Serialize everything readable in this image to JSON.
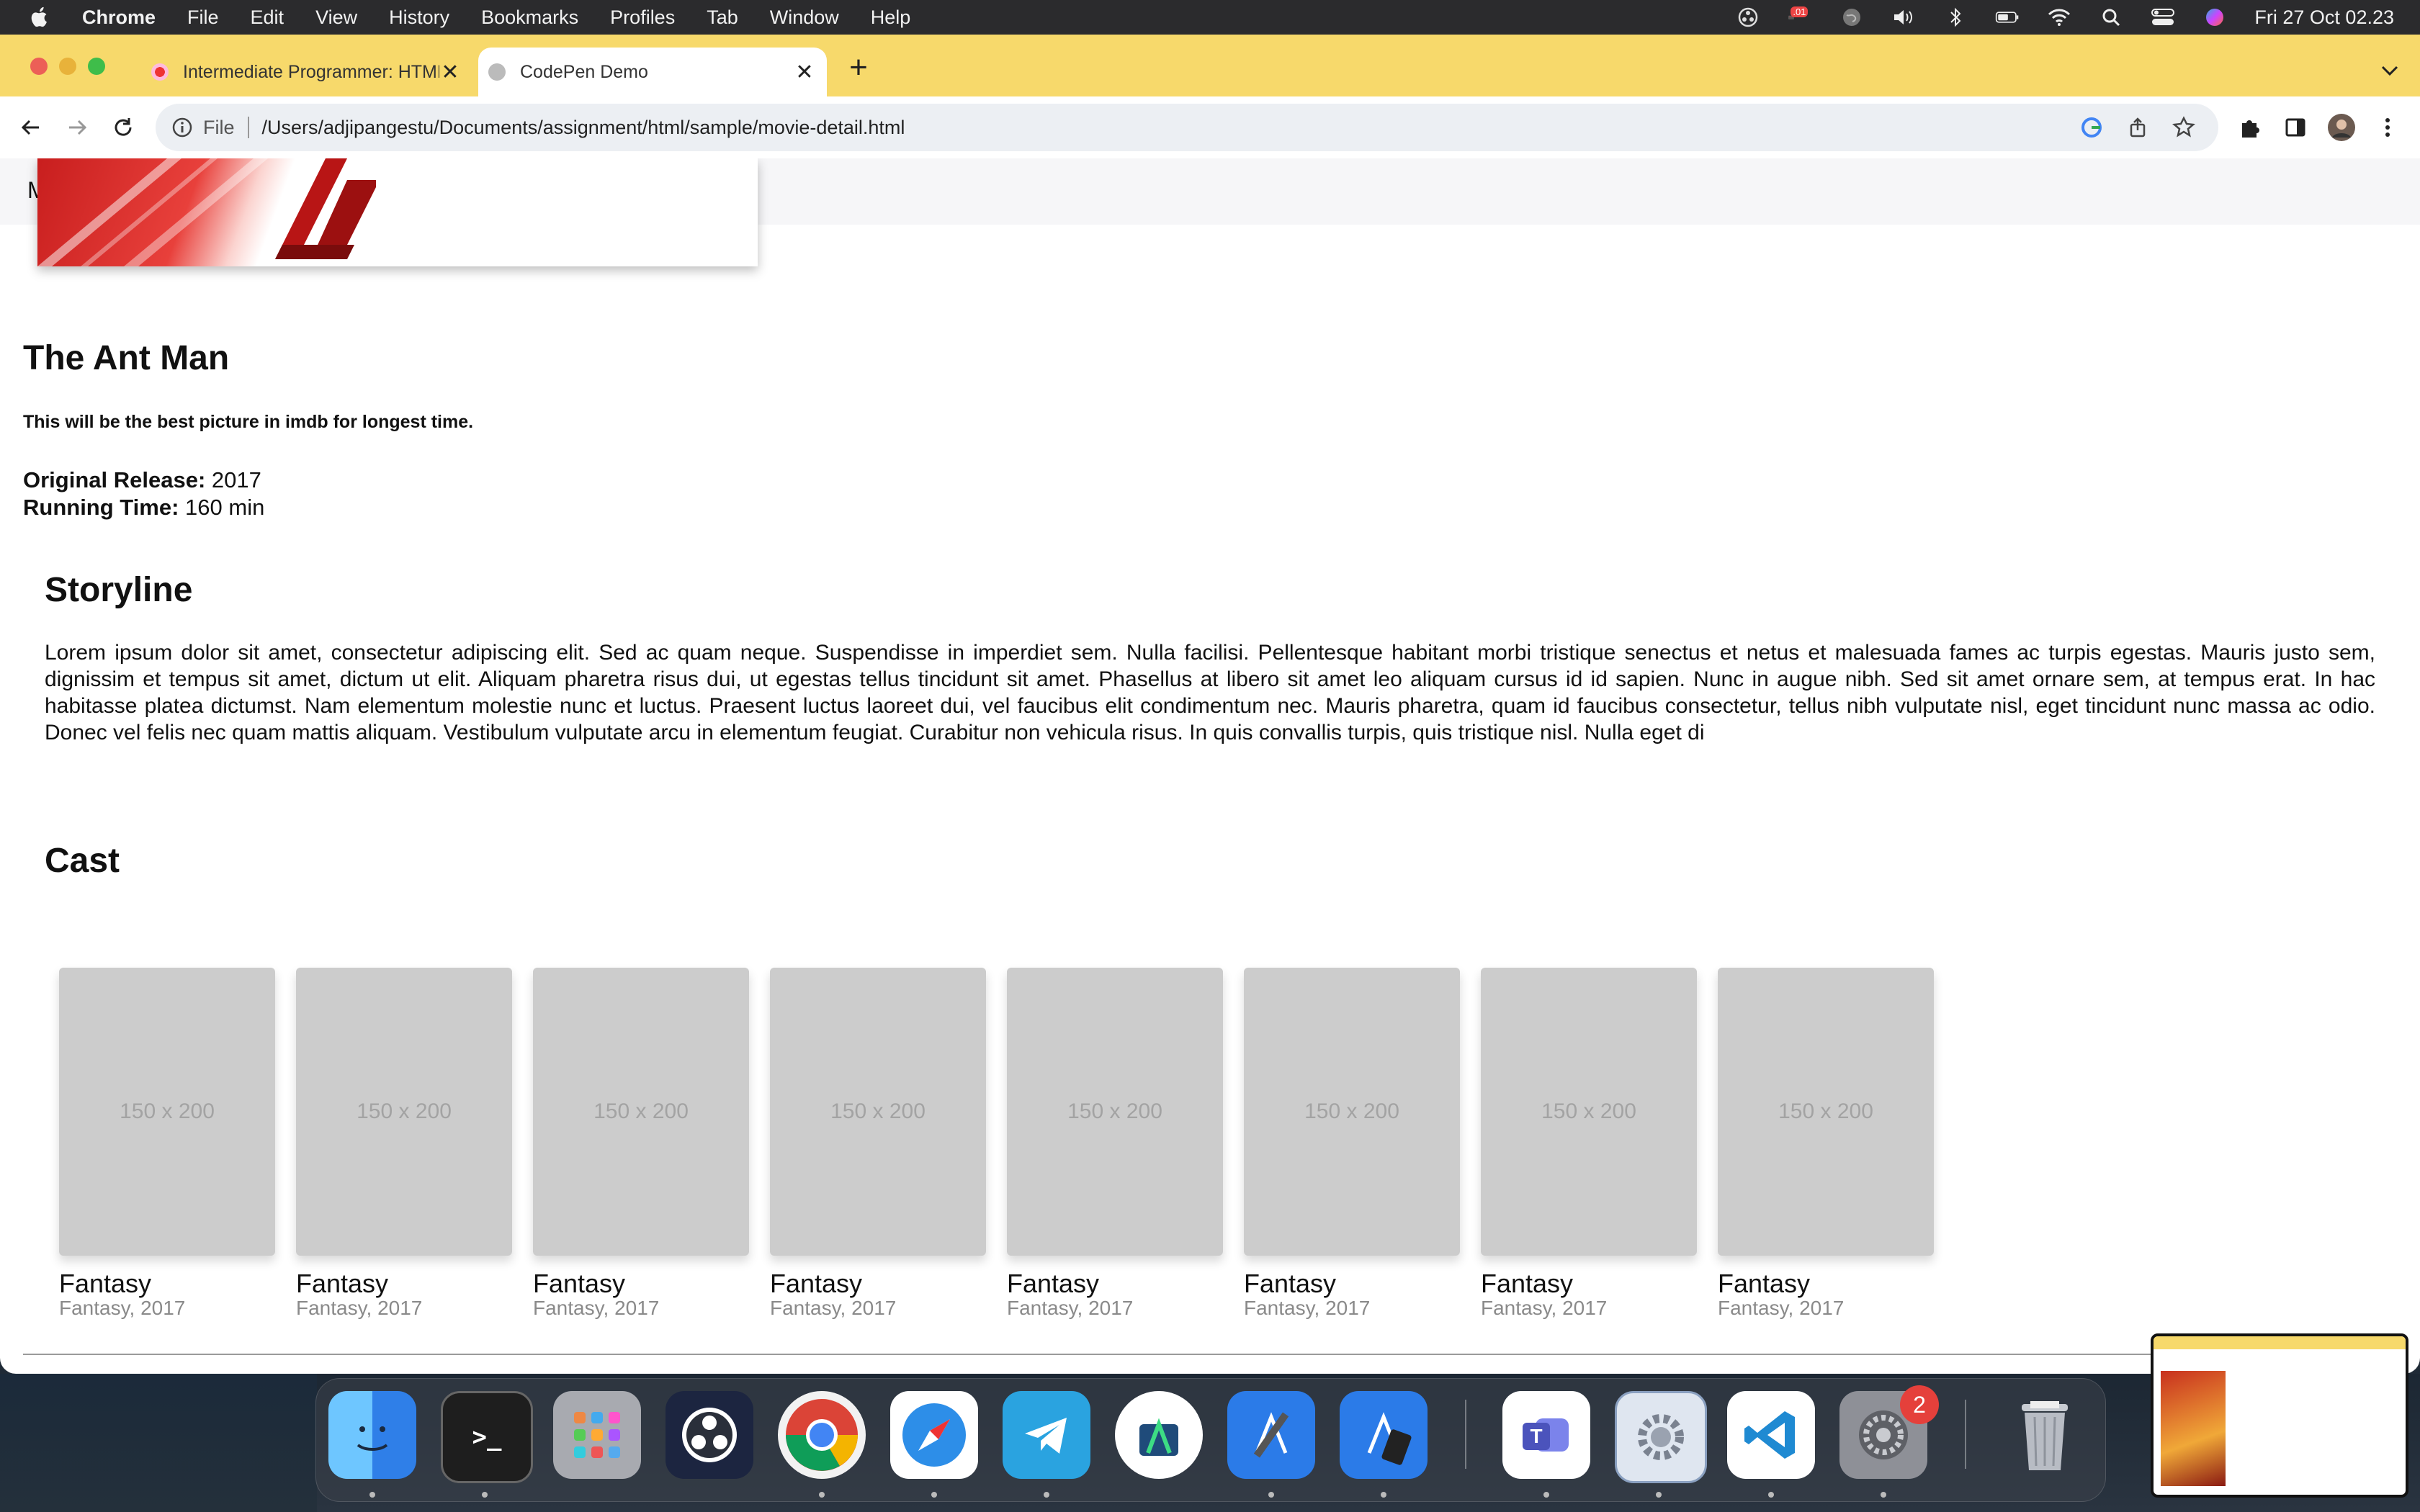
{
  "menubar": {
    "app": "Chrome",
    "items": [
      "File",
      "Edit",
      "View",
      "History",
      "Bookmarks",
      "Profiles",
      "Tab",
      "Window",
      "Help"
    ],
    "clock": "Fri 27 Oct  02.23",
    "badge": ".01"
  },
  "tabs": [
    {
      "title": "Intermediate Programmer: HTML",
      "active": false
    },
    {
      "title": "CodePen Demo",
      "active": true
    }
  ],
  "omnibox": {
    "file_label": "File",
    "url": "/Users/adjipangestu/Documents/assignment/html/sample/movie-detail.html"
  },
  "page": {
    "nav_initial": "M",
    "title": "The Ant Man",
    "tagline": "This will be the best picture in imdb for longest time.",
    "facts": [
      {
        "label": "Original Release:",
        "value": "2017"
      },
      {
        "label": "Running Time:",
        "value": "160 min"
      }
    ],
    "storyline_heading": "Storyline",
    "storyline": "Lorem ipsum dolor sit amet, consectetur adipiscing elit. Sed ac quam neque. Suspendisse in imperdiet sem. Nulla facilisi. Pellentesque habitant morbi tristique senectus et netus et malesuada fames ac turpis egestas. Mauris justo sem, dignissim et tempus sit amet, dictum ut elit. Aliquam pharetra risus dui, ut egestas tellus tincidunt sit amet. Phasellus at libero sit amet leo aliquam cursus id id sapien. Nunc in augue nibh. Sed sit amet ornare sem, at tempus erat. In hac habitasse platea dictumst. Nam elementum molestie nunc et luctus. Praesent luctus laoreet dui, vel faucibus elit condimentum nec. Mauris pharetra, quam id faucibus consectetur, tellus nibh vulputate nisl, eget tincidunt nunc massa ac odio. Donec vel felis nec quam mattis aliquam. Vestibulum vulputate arcu in elementum feugiat. Curabitur non vehicula risus. In quis convallis turpis, quis tristique nisl. Nulla eget di",
    "cast_heading": "Cast",
    "cast": [
      {
        "placeholder": "150 x 200",
        "name": "Fantasy",
        "meta": "Fantasy, 2017"
      },
      {
        "placeholder": "150 x 200",
        "name": "Fantasy",
        "meta": "Fantasy, 2017"
      },
      {
        "placeholder": "150 x 200",
        "name": "Fantasy",
        "meta": "Fantasy, 2017"
      },
      {
        "placeholder": "150 x 200",
        "name": "Fantasy",
        "meta": "Fantasy, 2017"
      },
      {
        "placeholder": "150 x 200",
        "name": "Fantasy",
        "meta": "Fantasy, 2017"
      },
      {
        "placeholder": "150 x 200",
        "name": "Fantasy",
        "meta": "Fantasy, 2017"
      },
      {
        "placeholder": "150 x 200",
        "name": "Fantasy",
        "meta": "Fantasy, 2017"
      },
      {
        "placeholder": "150 x 200",
        "name": "Fantasy",
        "meta": "Fantasy, 2017"
      }
    ]
  },
  "dock": {
    "apps": [
      "finder",
      "terminal",
      "launchpad",
      "obs",
      "chrome",
      "safari",
      "telegram",
      "android-studio",
      "xcode",
      "app-store-connect",
      "teams",
      "settings-gear",
      "vscode",
      "system-settings",
      "trash"
    ],
    "terminal_glyph": ">_",
    "settings_badge": "2"
  },
  "colors": {
    "tabbar": "#f7d96b",
    "menubar": "#2b2b2d",
    "placeholder_bg": "#cccccc",
    "poster_red": "#c81e1e"
  }
}
